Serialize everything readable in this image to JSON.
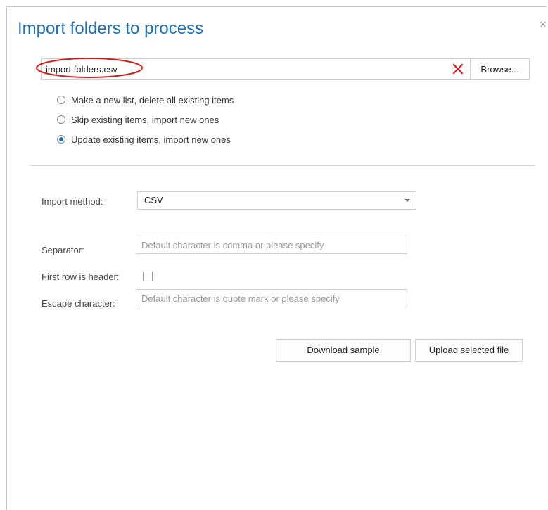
{
  "dialog": {
    "title": "Import folders to process",
    "close_label": "×"
  },
  "file": {
    "name": "import folders.csv",
    "browse_label": "Browse..."
  },
  "import_modes": [
    {
      "label": "Make a new list, delete all existing items",
      "selected": false
    },
    {
      "label": "Skip existing items, import new ones",
      "selected": false
    },
    {
      "label": "Update existing items, import new ones",
      "selected": true
    }
  ],
  "import_method": {
    "label": "Import method:",
    "value": "CSV"
  },
  "separator": {
    "label": "Separator:",
    "value": "",
    "placeholder": "Default character is comma or please specify"
  },
  "first_row_header": {
    "label": "First row is header:",
    "checked": false
  },
  "escape_character": {
    "label": "Escape character:",
    "value": "",
    "placeholder": "Default character is quote mark or please specify"
  },
  "actions": {
    "download_sample": "Download sample",
    "upload_selected": "Upload selected file"
  },
  "colors": {
    "title": "#2072b8",
    "clear_icon": "#d01f1f",
    "highlight_ellipse": "#d41d1d",
    "radio_selected": "#1e6fb5"
  }
}
